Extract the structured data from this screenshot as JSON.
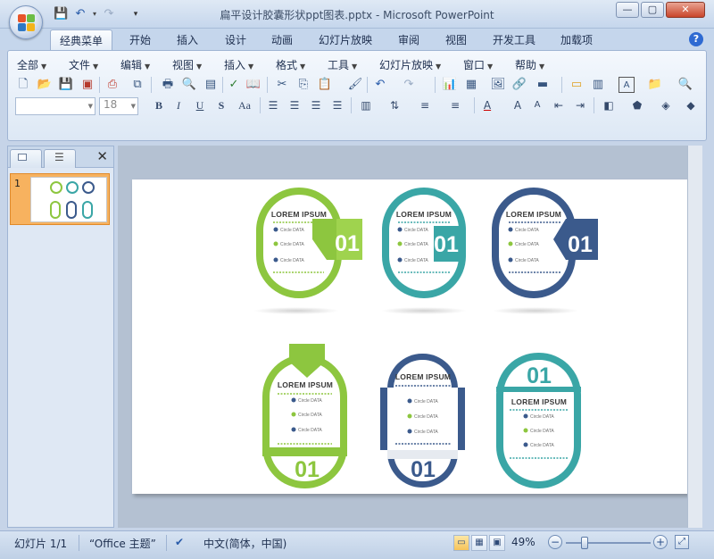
{
  "window": {
    "title": "扁平设计胶囊形状ppt图表.pptx - Microsoft PowerPoint",
    "controls": {
      "minimize": "—",
      "maximize": "▢",
      "close": "✕"
    }
  },
  "ribbon_tabs": [
    "经典菜单",
    "开始",
    "插入",
    "设计",
    "动画",
    "幻灯片放映",
    "审阅",
    "视图",
    "开发工具",
    "加载项"
  ],
  "menu_bar": [
    "全部",
    "文件",
    "编辑",
    "视图",
    "插入",
    "格式",
    "工具",
    "幻灯片放映",
    "窗口",
    "帮助"
  ],
  "format_bar": {
    "font_name": "",
    "font_size": "18",
    "buttons": {
      "bold": "B",
      "italic": "I",
      "underline": "U",
      "shadow": "S",
      "case": "Aa"
    }
  },
  "left_pane": {
    "close": "✕",
    "slide_number": "1"
  },
  "slide": {
    "capsules": [
      {
        "title": "LOREM IPSUM",
        "number": "01",
        "items": [
          "Circle DATA",
          "Circle DATA",
          "Circle DATA"
        ]
      },
      {
        "title": "LOREM IPSUM",
        "number": "01",
        "items": [
          "Circle DATA",
          "Circle DATA",
          "Circle DATA"
        ]
      },
      {
        "title": "LOREM IPSUM",
        "number": "01",
        "items": [
          "Circle DATA",
          "Circle DATA",
          "Circle DATA"
        ]
      },
      {
        "title": "LOREM IPSUM",
        "number": "01",
        "items": [
          "Circle DATA",
          "Circle DATA",
          "Circle DATA"
        ]
      },
      {
        "title": "LOREM IPSUM",
        "number": "01",
        "items": [
          "Circle DATA",
          "Circle DATA",
          "Circle DATA"
        ]
      },
      {
        "title": "LOREM IPSUM",
        "number": "01",
        "items": [
          "Circle DATA",
          "Circle DATA",
          "Circle DATA"
        ]
      }
    ],
    "colors": {
      "green": "#8dc63f",
      "teal": "#3aa6a6",
      "navy": "#3b5a8c"
    }
  },
  "status_bar": {
    "slide_info": "幻灯片 1/1",
    "theme": "“Office 主题”",
    "language": "中文(简体，中国)",
    "zoom": "49%",
    "zoom_minus": "−",
    "zoom_plus": "+"
  },
  "icons": [
    "office-button-icon",
    "save-icon",
    "undo-icon",
    "redo-icon",
    "help-icon"
  ]
}
